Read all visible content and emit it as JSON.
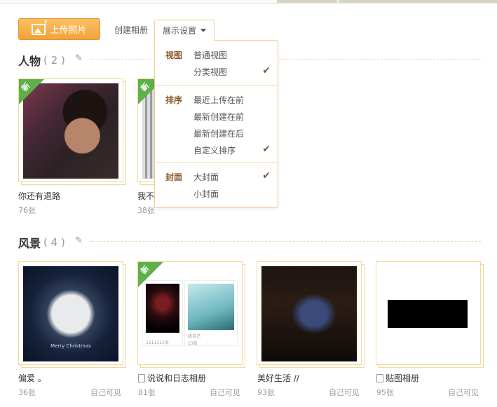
{
  "toolbar": {
    "upload_label": "上传照片",
    "create_label": "创建相册",
    "display_label": "展示设置"
  },
  "dropdown": {
    "view": {
      "heading": "视图",
      "items": [
        "普通视图",
        "分类视图"
      ],
      "checked": "分类视图"
    },
    "sort": {
      "heading": "排序",
      "items": [
        "最近上传在前",
        "最新创建在前",
        "最新创建在后",
        "自定义排序"
      ],
      "checked": "自定义排序"
    },
    "cover": {
      "heading": "封面",
      "items": [
        "大封面",
        "小封面"
      ],
      "checked": "大封面"
    }
  },
  "sections": [
    {
      "title": "人物",
      "count": "2",
      "albums": [
        {
          "name": "你还有退路",
          "count": "76张",
          "visibility": "",
          "new": true
        },
        {
          "name": "我不",
          "count": "38张",
          "visibility": "",
          "new": true
        }
      ]
    },
    {
      "title": "风景",
      "count": "4",
      "albums": [
        {
          "name": "偏爱 。",
          "count": "36张",
          "visibility": "自己可见",
          "new": false,
          "caption": "Merry Christmas"
        },
        {
          "name": "说说和日志相册",
          "count": "81张",
          "visibility": "自己可见",
          "new": true,
          "doc_icon": true,
          "sub_labels": [
            "1111111张",
            "我自己",
            "13张"
          ]
        },
        {
          "name": "美好生活 //",
          "count": "93张",
          "visibility": "自己可见",
          "new": false
        },
        {
          "name": "贴图相册",
          "count": "95张",
          "visibility": "自己可见",
          "new": false,
          "doc_icon": true
        }
      ]
    }
  ],
  "icons": {
    "check": "✔",
    "pencil": "✎",
    "new_badge": "新"
  },
  "colors": {
    "upload_button": "#f2a33a",
    "accent_border": "#f0cf8e",
    "new_badge": "#5fb04a"
  }
}
